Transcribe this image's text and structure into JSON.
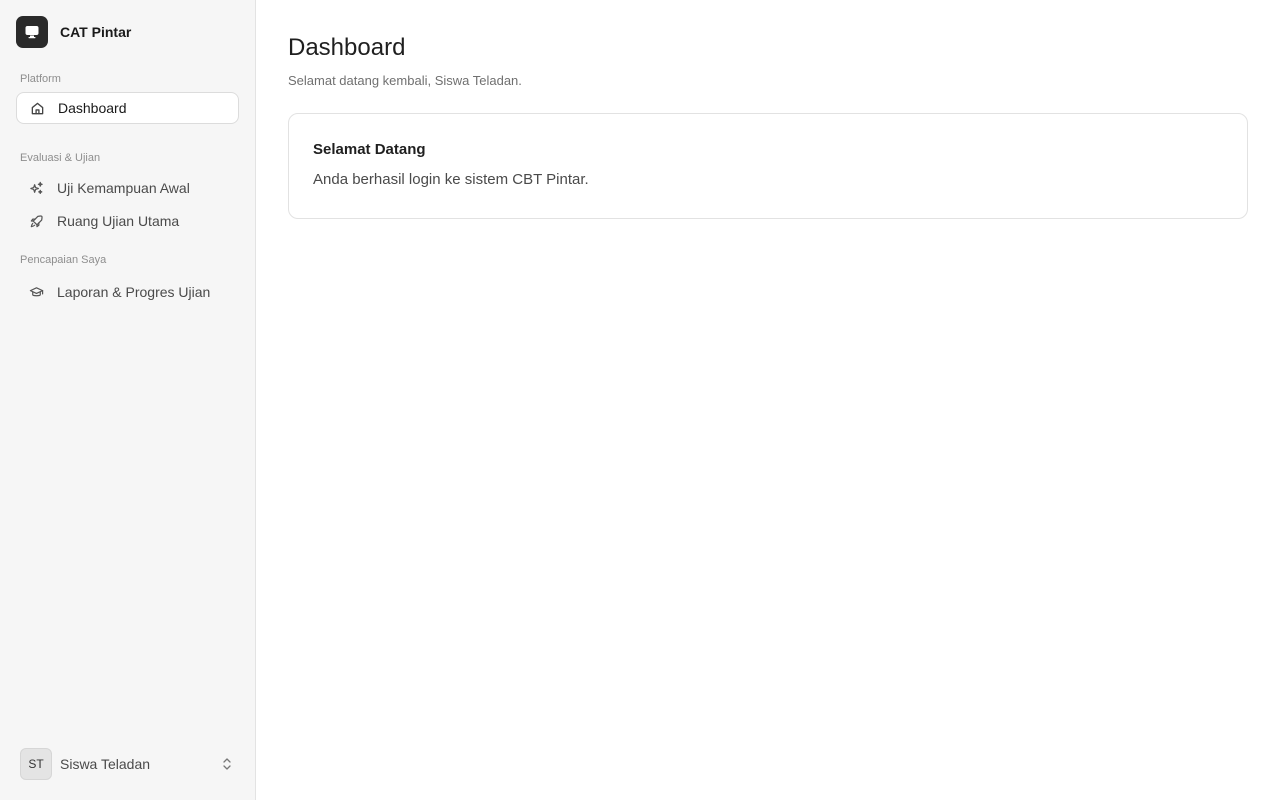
{
  "app": {
    "name": "CAT Pintar",
    "logo_icon": "monitor-icon"
  },
  "sidebar": {
    "groups": [
      {
        "label": "Platform",
        "items": [
          {
            "label": "Dashboard",
            "icon": "home-icon",
            "active": true
          }
        ]
      },
      {
        "label": "Evaluasi & Ujian",
        "items": [
          {
            "label": "Uji Kemampuan Awal",
            "icon": "sparkles-icon",
            "active": false
          },
          {
            "label": "Ruang Ujian Utama",
            "icon": "rocket-icon",
            "active": false
          }
        ]
      },
      {
        "label": "Pencapaian Saya",
        "items": [
          {
            "label": "Laporan & Progres Ujian",
            "icon": "graduation-cap-icon",
            "active": false
          }
        ]
      }
    ],
    "user": {
      "initials": "ST",
      "name": "Siswa Teladan",
      "menu_icon": "chevrons-up-down-icon"
    }
  },
  "main": {
    "title": "Dashboard",
    "subtitle": "Selamat datang kembali, Siswa Teladan.",
    "card": {
      "title": "Selamat Datang",
      "text": "Anda berhasil login ke sistem CBT Pintar."
    }
  },
  "colors": {
    "sidebar_bg": "#f6f6f6",
    "logo_bg": "#2a2a2a",
    "border": "#e2e2e2"
  }
}
